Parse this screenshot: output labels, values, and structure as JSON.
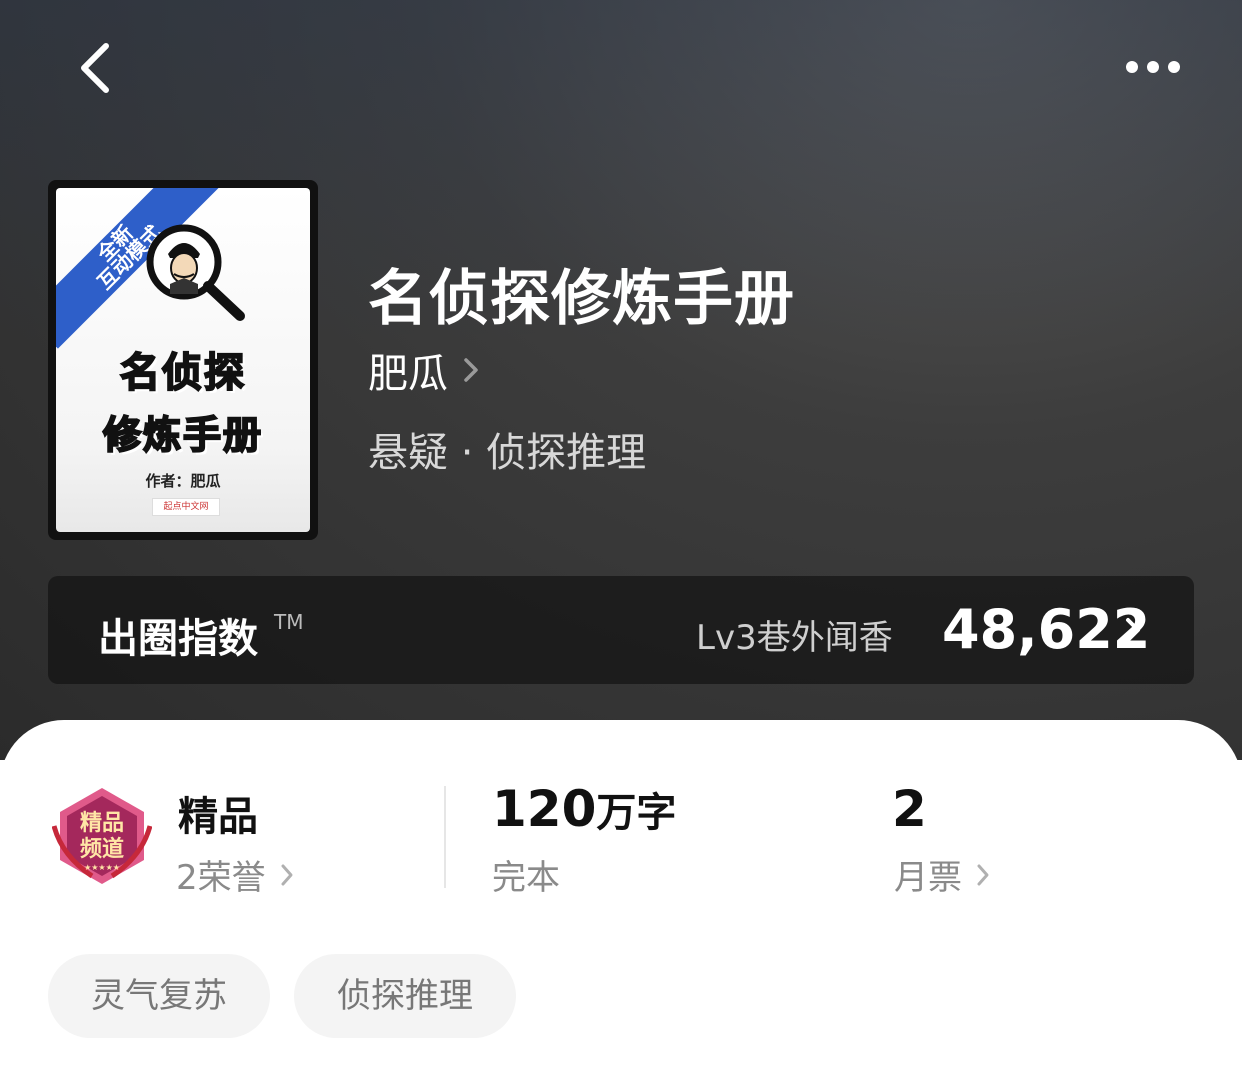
{
  "nav": {
    "back_icon": "chevron-left-icon",
    "more_icon": "more-horizontal-icon"
  },
  "cover": {
    "ribbon_line1": "全新",
    "ribbon_line2": "互动模式",
    "title_line1": "名侦探",
    "title_line2": "修炼手册",
    "author_line": "作者：肥瓜",
    "publisher_mark": "起点中文网"
  },
  "book": {
    "title": "名侦探修炼手册",
    "author": "肥瓜",
    "genre": "悬疑 · 侦探推理"
  },
  "index": {
    "label": "出圈指数",
    "tm": "TM",
    "level": "Lv3巷外闻香",
    "value": "48,622"
  },
  "stats": {
    "quality_title": "精品",
    "quality_sub": "2荣誉",
    "words_num": "120",
    "words_unit": "万字",
    "status": "完本",
    "tickets_num": "2",
    "tickets_label": "月票"
  },
  "badge": {
    "line1": "精品",
    "line2": "频道"
  },
  "tags": [
    "灵气复苏",
    "侦探推理"
  ],
  "colors": {
    "hero_bg": "#3d3d3d",
    "ribbon_blue": "#2e5fc9",
    "badge_magenta": "#a4285c",
    "text_muted": "#8a8a8a",
    "tag_bg": "#f4f4f4"
  }
}
